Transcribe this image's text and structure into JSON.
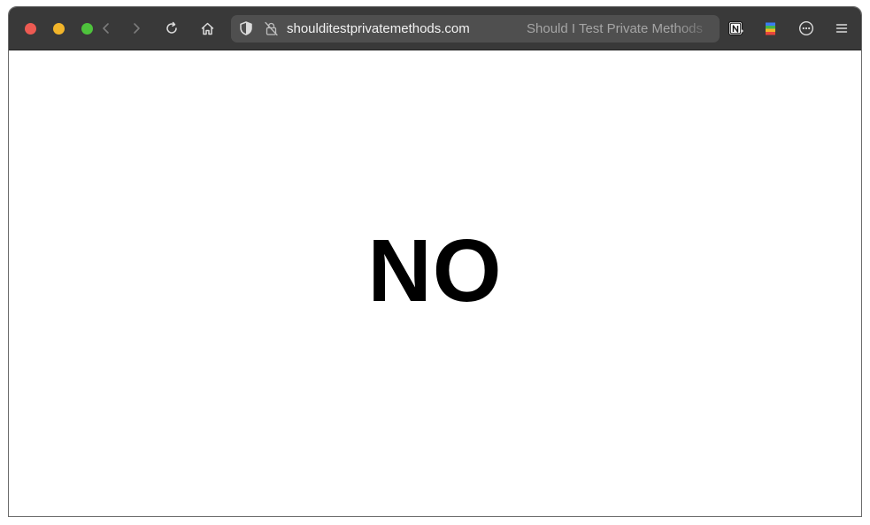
{
  "browser": {
    "url": "shoulditestprivatemethods.com",
    "tab_title": "Should I Test Private Methods",
    "toolbar_icons": [
      "back-icon",
      "forward-icon",
      "reload-icon",
      "home-icon",
      "shield-icon",
      "insecure-lock-icon",
      "notion-extension-icon",
      "color-extension-icon",
      "more-options-icon",
      "menu-icon"
    ]
  },
  "page": {
    "answer": "NO"
  },
  "colors": {
    "toolbar_bg": "#393939",
    "urlbar_bg": "#4f4f4f",
    "close": "#ed5a52",
    "minimize": "#f2b52a",
    "zoom": "#4ec33c",
    "page_bg": "#ffffff",
    "answer_text": "#000000"
  }
}
